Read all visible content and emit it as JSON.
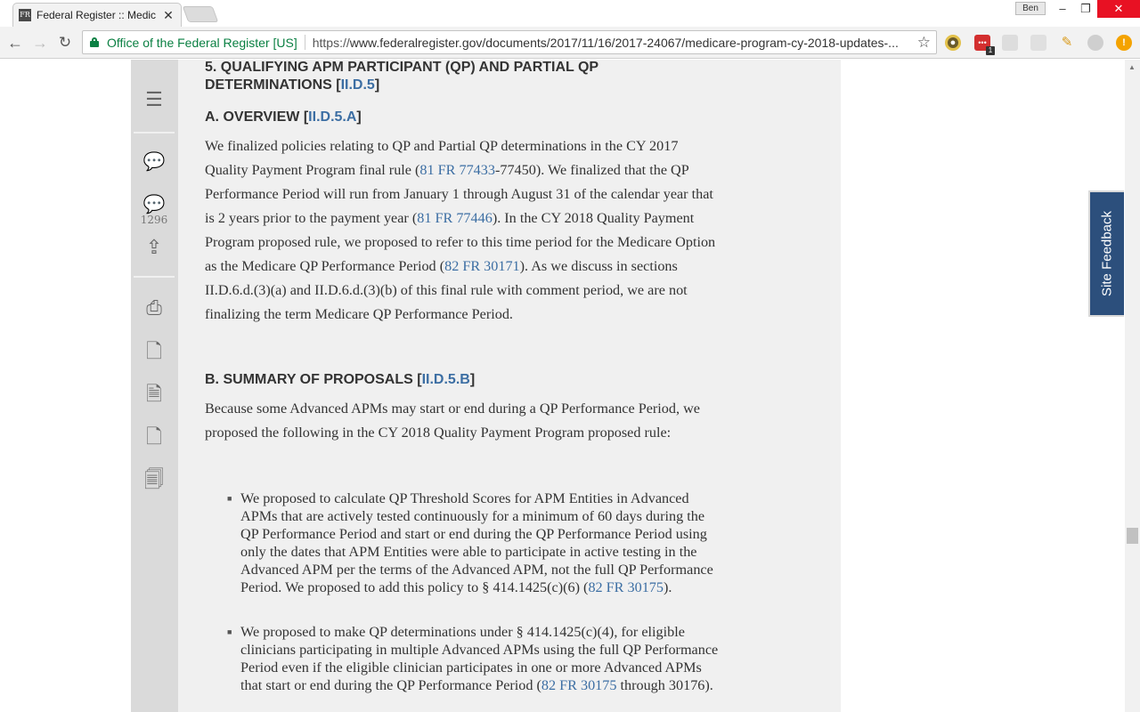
{
  "browser": {
    "tab_title": "Federal Register :: Medic",
    "tab_favicon": "FR",
    "profile_name": "Ben",
    "site_identity": "Office of the Federal Register [US]",
    "url_protocol": "https://",
    "url_rest": "www.federalregister.gov/documents/2017/11/16/2017-24067/medicare-program-cy-2018-updates-...",
    "ext_badge": "1"
  },
  "sidebar": {
    "comment_count": "1296"
  },
  "doc": {
    "section5_line1": "5. QUALIFYING APM PARTICIPANT (QP) AND PARTIAL QP",
    "section5_line2_pre": "DETERMINATIONS [",
    "section5_ref": "II.D.5",
    "bracket_close": "]",
    "overview_pre": "A. OVERVIEW [",
    "overview_ref": "II.D.5.A",
    "overview_para": {
      "t1": "We finalized policies relating to QP and Partial QP determinations in the CY 2017 Quality Payment Program final rule (",
      "l1": "81 FR 77433",
      "t2": "-77450). We finalized that the QP Performance Period will run from January 1 through August 31 of the calendar year that is 2 years prior to the payment year (",
      "l2": "81 FR 77446",
      "t3": "). In the CY 2018 Quality Payment Program proposed rule, we proposed to refer to this time period for the Medicare Option as the Medicare QP Performance Period (",
      "l3": "82 FR 30171",
      "t4": "). As we discuss in sections II.D.6.d.(3)(a) and II.D.6.d.(3)(b) of this final rule with comment period, we are not finalizing the term Medicare QP Performance Period."
    },
    "summary_pre": "B. SUMMARY OF PROPOSALS [",
    "summary_ref": "II.D.5.B",
    "summary_para": "Because some Advanced APMs may start or end during a QP Performance Period, we proposed the following in the CY 2018 Quality Payment Program proposed rule:",
    "bullet1": {
      "t1": "We proposed to calculate QP Threshold Scores for APM Entities in Advanced APMs that are actively tested continuously for a minimum of 60 days during the QP Performance Period and start or end during the QP Performance Period using only the dates that APM Entities were able to participate in active testing in the Advanced APM per the terms of the Advanced APM, not the full QP Performance Period. We proposed to add this policy to § 414.1425(c)(6) (",
      "l1": "82 FR 30175",
      "t2": ")."
    },
    "bullet2": {
      "t1": "We proposed to make QP determinations under § 414.1425(c)(4), for eligible clinicians participating in multiple Advanced APMs using the full QP Performance Period even if the eligible clinician participates in one or more Advanced APMs that start or end during the QP Performance Period (",
      "l1": "82 FR 30175",
      "t2": " through 30176)."
    }
  },
  "feedback": {
    "label": "Site Feedback"
  }
}
